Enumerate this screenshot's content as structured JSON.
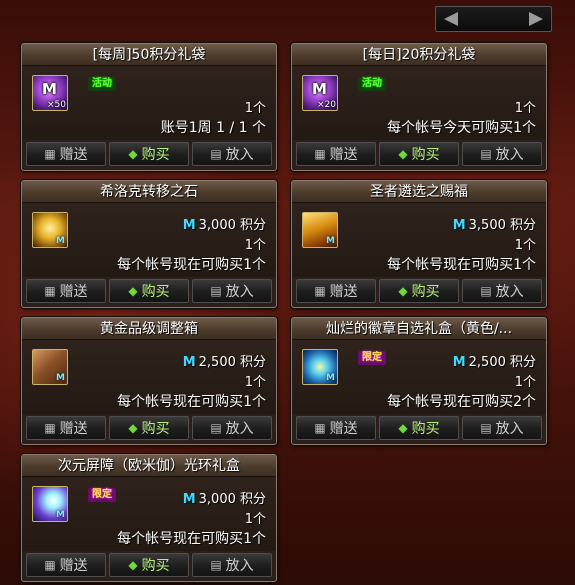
{
  "pager": {
    "prev_icon": "left-arrow-icon",
    "next_icon": "right-arrow-icon"
  },
  "buttons": {
    "gift": "赠送",
    "buy": "购买",
    "cart": "放入"
  },
  "cards": [
    {
      "title": "[每周]50积分礼袋",
      "icon": "purple-m-bag-icon",
      "icon_mark": "M",
      "icon_qty": "×50",
      "badge": "活动",
      "badge_type": "event",
      "price_icon": "",
      "price": "",
      "count": "1个",
      "limit": "账号1周 1 / 1 个"
    },
    {
      "title": "[每日]20积分礼袋",
      "icon": "purple-m-bag-icon",
      "icon_mark": "M",
      "icon_qty": "×20",
      "badge": "活动",
      "badge_type": "event",
      "price_icon": "",
      "price": "",
      "count": "1个",
      "limit": "每个帐号今天可购买1个"
    },
    {
      "title": "希洛克转移之石",
      "icon": "gold-gauntlet-icon",
      "icon_mark": "",
      "icon_qty": "",
      "badge": "",
      "badge_type": "",
      "price_icon": "M",
      "price": "3,000 积分",
      "count": "1个",
      "limit": "每个帐号现在可购买1个"
    },
    {
      "title": "圣者遴选之赐福",
      "icon": "gold-chest-icon",
      "icon_mark": "",
      "icon_qty": "",
      "badge": "",
      "badge_type": "",
      "price_icon": "M",
      "price": "3,500 积分",
      "count": "1个",
      "limit": "每个帐号现在可购买1个"
    },
    {
      "title": "黄金品级调整箱",
      "icon": "brown-box-icon",
      "icon_mark": "",
      "icon_qty": "",
      "badge": "",
      "badge_type": "",
      "price_icon": "M",
      "price": "2,500 积分",
      "count": "1个",
      "limit": "每个帐号现在可购买1个"
    },
    {
      "title": "灿烂的徽章自选礼盒（黄色/...",
      "icon": "badge-box-icon",
      "icon_mark": "",
      "icon_qty": "",
      "badge": "限定",
      "badge_type": "limited",
      "price_icon": "M",
      "price": "2,500 积分",
      "count": "1个",
      "limit": "每个帐号现在可购买2个"
    },
    {
      "title": "次元屏障（欧米伽）光环礼盒",
      "icon": "aura-box-icon",
      "icon_mark": "",
      "icon_qty": "",
      "badge": "限定",
      "badge_type": "limited",
      "price_icon": "M",
      "price": "3,000 积分",
      "count": "1个",
      "limit": "每个帐号现在可购买1个"
    }
  ]
}
